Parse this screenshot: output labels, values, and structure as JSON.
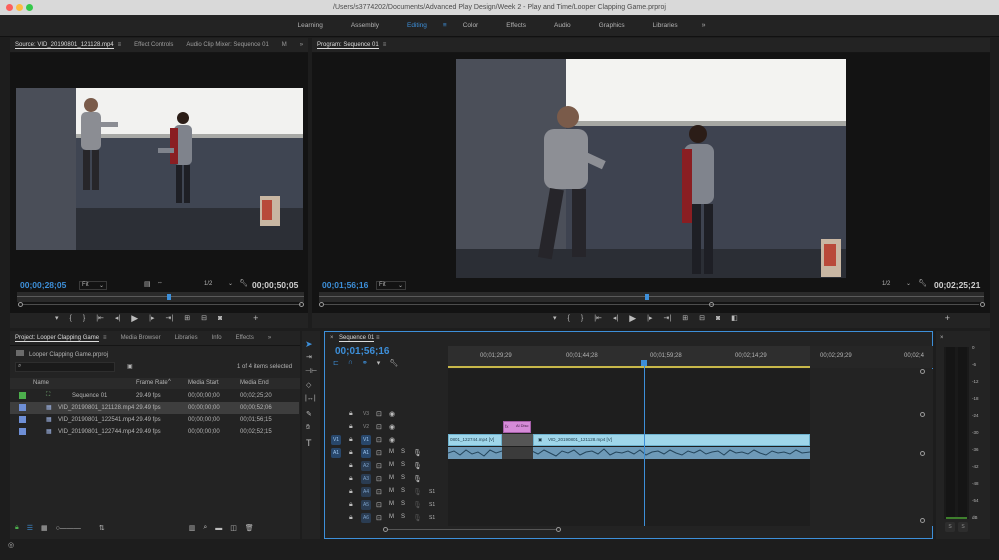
{
  "window": {
    "title": "/Users/s3774202/Documents/Advanced Play Design/Week 2 - Play and Time/Looper Clapping Game.prproj"
  },
  "workspaces": {
    "tabs": [
      "Learning",
      "Assembly",
      "Editing",
      "Color",
      "Effects",
      "Audio",
      "Graphics",
      "Libraries"
    ],
    "active": "Editing",
    "more": "»"
  },
  "source_panel": {
    "tabs": [
      "Source: VID_20190801_121128.mp4",
      "Effect Controls",
      "Audio Clip Mixer: Sequence 01",
      "M"
    ],
    "more": "»",
    "timecode_in": "00;00;28;05",
    "fit": "Fit",
    "resolution": "1/2",
    "timecode_out": "00;00;50;05"
  },
  "program_panel": {
    "tab": "Program: Sequence 01",
    "timecode_in": "00;01;56;16",
    "fit": "Fit",
    "resolution": "1/2",
    "timecode_out": "00;02;25;21"
  },
  "project_panel": {
    "tabs": [
      "Project: Looper Clapping Game",
      "Media Browser",
      "Libraries",
      "Info",
      "Effects"
    ],
    "more": "»",
    "project_file": "Looper Clapping Game.prproj",
    "items_selected": "1 of 4 items selected",
    "columns": [
      "Name",
      "Frame Rate",
      "Media Start",
      "Media End"
    ],
    "rows": [
      {
        "name": "Sequence 01",
        "frame_rate": "29.49 fps",
        "media_start": "00;00;00;00",
        "media_end": "00;02;25;20",
        "color": "#4cae4c",
        "selected": false
      },
      {
        "name": "VID_20190801_121128.mp4",
        "frame_rate": "29.49 fps",
        "media_start": "00;00;00;00",
        "media_end": "00;00;52;06",
        "color": "#6e8fd6",
        "selected": true
      },
      {
        "name": "VID_20190801_122541.mp4",
        "frame_rate": "29.49 fps",
        "media_start": "00;00;00;00",
        "media_end": "00;01;56;15",
        "color": "#6e8fd6",
        "selected": false
      },
      {
        "name": "VID_20190801_122744.mp4",
        "frame_rate": "29.49 fps",
        "media_start": "00;00;00;00",
        "media_end": "00;02;52;15",
        "color": "#6e8fd6",
        "selected": false
      }
    ]
  },
  "timeline": {
    "tab": "Sequence 01",
    "timecode": "00;01;56;16",
    "ruler_labels": [
      "00;01;29;29",
      "00;01;44;28",
      "00;01;59;28",
      "00;02;14;29",
      "00;02;29;29",
      "00;02;4"
    ],
    "video_tracks": [
      "V3",
      "V2",
      "V1"
    ],
    "audio_tracks": [
      "A1",
      "A2",
      "A3",
      "A4",
      "A5",
      "A6"
    ],
    "source_v": "V1",
    "source_a": "A1",
    "clip_v1_left": "0801_122744.mp4 [V]",
    "clip_v1_right": "VID_20190801_121128.mp4 [V]",
    "clip_v2": "Al Disc",
    "m_label": "M",
    "s_label": "S",
    "s1_label": "S1"
  },
  "meter": {
    "scale": [
      "0",
      "-6",
      "-12",
      "-18",
      "-24",
      "-30",
      "-36",
      "-42",
      "-48",
      "-54",
      "dB"
    ],
    "solo_left": "S",
    "solo_right": "S"
  }
}
